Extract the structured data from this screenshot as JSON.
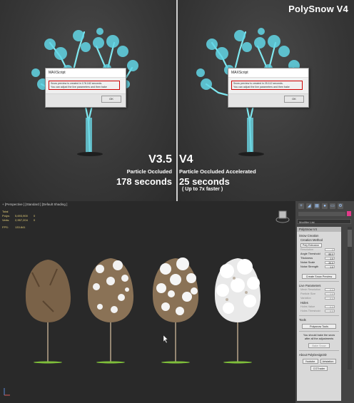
{
  "brand": "PolySnow V4",
  "left": {
    "dialog": {
      "title": "MAXScript",
      "message_line1": "Snow preview is created in 178.182 seconds.",
      "message_line2": "You can adjust the live parameters and then bake",
      "ok": "OK"
    },
    "version": "V3.5",
    "subtitle": "Particle Occluded",
    "time": "178 seconds"
  },
  "right": {
    "dialog": {
      "title": "MAXScript",
      "message_line1": "Snow preview is created in 25.112 seconds.",
      "message_line2": "You can adjust the live parameters and then bake",
      "ok": "OK"
    },
    "version": "V4",
    "subtitle": "Particle Occluded Accelerated",
    "time": "25 seconds",
    "note": "( Up to 7x faster )"
  },
  "viewport": {
    "label": "+ [Perspective ] [Standard ] [Default Shading ]",
    "stats": {
      "total_label": "Total",
      "polys_label": "Polys:",
      "polys_value": "5,693,900",
      "polys_sel": "0",
      "verts_label": "Verts:",
      "verts_value": "2,957,204",
      "verts_sel": "0",
      "fps_label": "FPS:",
      "fps_value": "133.841"
    }
  },
  "panel": {
    "modifier_list": "Modifier List",
    "header": "PolySnow V4",
    "snow_creation": "Snow Creation",
    "creation_method": "Creation Method",
    "method_value": "Poly Extrusion",
    "fields": [
      {
        "label": "Resolution",
        "value": "0",
        "dim": true
      },
      {
        "label": "Angle Threshold",
        "value": "85.0",
        "dim": false
      },
      {
        "label": "Thickness",
        "value": "1.0",
        "dim": false
      },
      {
        "label": "Noise Scale",
        "value": "20.0",
        "dim": false
      },
      {
        "label": "Noise Strength",
        "value": "1.0",
        "dim": false
      }
    ],
    "create_preview": "Create Snow Preview",
    "live_params": "Live Parameters",
    "live_fields": [
      {
        "label": "Mesh Resolution",
        "value": "0.0"
      },
      {
        "label": "Particle Size",
        "value": "1.0"
      },
      {
        "label": "Variation",
        "value": "0.0"
      }
    ],
    "holes": "Holes",
    "hole_fields": [
      {
        "label": "Holes Value",
        "value": "0.0"
      },
      {
        "label": "Holes Threshold",
        "value": "0.0"
      }
    ],
    "tools": "Tools",
    "polysnow_tools": "Polysnow Tools",
    "bake_note1": "You should bake the snow",
    "bake_note2": "after all the adjustments",
    "bake_snow": "Bake Snow",
    "about": "About PolyDesign3D",
    "youtube": "Youtube",
    "artstation": "Artstation",
    "cgtrader": "CGTrader"
  }
}
